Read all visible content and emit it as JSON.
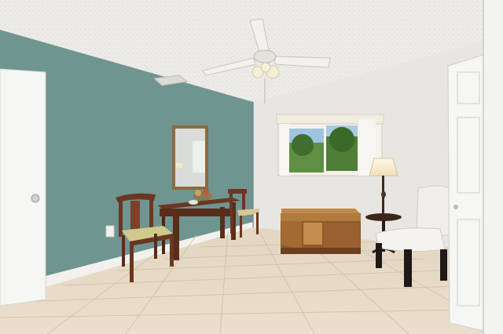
{
  "scene": {
    "kind": "photograph",
    "room": "sitting room",
    "objects": [
      "textured-ceiling",
      "ceiling-fan",
      "air-vent",
      "sage-green-accent-wall",
      "white-wall",
      "window-with-blinds",
      "wall-mirror",
      "console-table",
      "dining-chair-left",
      "dining-chair-back",
      "cedar-chest",
      "side-table",
      "floor-lamp",
      "white-accent-chair",
      "door-left",
      "door-right",
      "tile-floor"
    ]
  },
  "colors": {
    "accent_wall": "#6f9590",
    "white_wall": "#e8e6e3",
    "ceiling": "#ecebe7",
    "floor": "#e5d9c4",
    "wood": "#6a3722",
    "cedar_chest": "#b07b3f",
    "door": "#f6f6f4",
    "foliage": "#4a7a38"
  }
}
